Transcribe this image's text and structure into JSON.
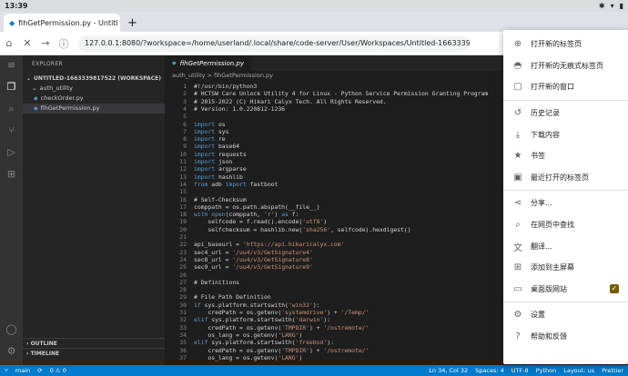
{
  "system_bar": {
    "time": "13:39"
  },
  "browser": {
    "tab_title": "fihGetPermission.py - Untitl",
    "url": "127.0.0.1:8080/?workspace=/home/userland/.local/share/code-server/User/Workspaces/Untitled-16633398175..."
  },
  "vscode": {
    "explorer_title": "EXPLORER",
    "workspace": "UNTITLED-1663339817522 (WORKSPACE)",
    "folder": "auth_utility",
    "files": [
      "checkOrder.py",
      "fihGetPermission.py"
    ],
    "outline": "OUTLINE",
    "timeline": "TIMELINE",
    "editor_tab": "fihGetPermission.py",
    "breadcrumb": "auth_utility > fihGetPermission.py",
    "status": {
      "branch": "main",
      "errors": "0 ⚠ 0",
      "position": "Ln 34, Col 32",
      "spaces": "Spaces: 4",
      "encoding": "UTF-8",
      "language": "Python",
      "layout": "Layout: us",
      "prettier": "Prettier"
    }
  },
  "code_lines": [
    "#!/usr/bin/python3",
    "# HCTSW Care Unlock Utility 4 for Linux - Python Service Permission Granting Program",
    "# 2015-2022 (C) Hikari Calyx Tech. All Rights Reserved.",
    "# Version: 1.0.220812-1236",
    "",
    "import os",
    "import sys",
    "import re",
    "import base64",
    "import requests",
    "import json",
    "import argparse",
    "import hashlib",
    "from adb import fastboot",
    "",
    "# Self-Checksum",
    "comppath = os.path.abspath(__file__)",
    "with open(comppath, 'r') as f:",
    "    selfcode = f.read().encode('utf8')",
    "    selfchecksum = hashlib.new('sha256', selfcode).hexdigest()",
    "",
    "api_baseurl = 'https://api.hikaricalyx.com'",
    "sec4_url = '/uu4/v3/GetSignature4'",
    "sec8_url = '/uu4/v3/GetSignature8'",
    "sec9_url = '/uu4/v3/GetSignature9'",
    "",
    "# Definitions",
    "",
    "# File Path Definition",
    "if sys.platform.startswith('win32'):",
    "    credPath = os.getenv('systemdrive') + '/Temp/'",
    "elif sys.platform.startswith('darwin'):",
    "    credPath = os.getenv('TMPDIR') + '/ostremote/'",
    "    os_lang = os.getenv('LANG')",
    "elif sys.platform.startswith('freebsd'):",
    "    credPath = os.getenv('TMPDIR') + '/ostremote/'",
    "    os_lang = os.getenv('LANG')"
  ],
  "menu": {
    "items": [
      {
        "icon": "new-tab-icon",
        "label": "打开新的标签页"
      },
      {
        "icon": "incognito-icon",
        "label": "打开新的无痕式标签页"
      },
      {
        "icon": "new-window-icon",
        "label": "打开新的窗口"
      },
      {
        "icon": "history-icon",
        "label": "历史记录"
      },
      {
        "icon": "download-icon",
        "label": "下载内容"
      },
      {
        "icon": "bookmark-icon",
        "label": "书签"
      },
      {
        "icon": "recent-tabs-icon",
        "label": "最近打开的标签页"
      },
      {
        "icon": "share-icon",
        "label": "分享..."
      },
      {
        "icon": "find-icon",
        "label": "在网页中查找"
      },
      {
        "icon": "translate-icon",
        "label": "翻译..."
      },
      {
        "icon": "add-home-icon",
        "label": "添加到主屏幕"
      },
      {
        "icon": "desktop-icon",
        "label": "桌面版网站",
        "checked": true
      },
      {
        "icon": "settings-icon",
        "label": "设置"
      },
      {
        "icon": "help-icon",
        "label": "帮助和反馈"
      }
    ]
  },
  "colors": {
    "accent": "#007acc",
    "checkbox": "#705e00"
  }
}
